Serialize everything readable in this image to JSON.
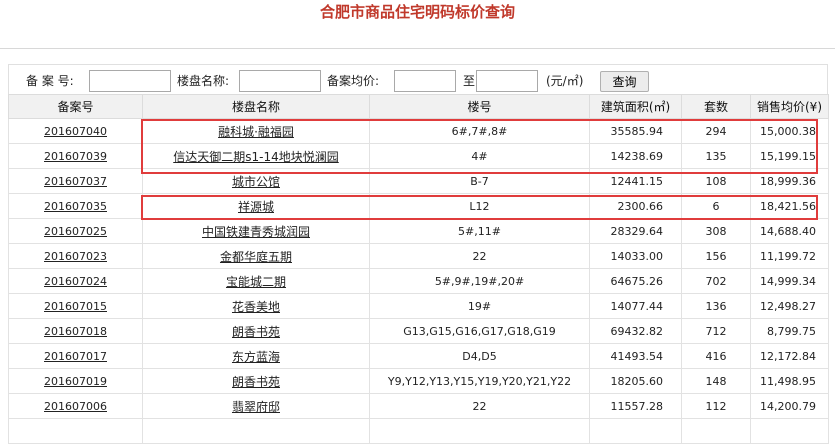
{
  "title": "合肥市商品住宅明码标价查询",
  "search": {
    "record_label": "备 案 号:",
    "name_label": "楼盘名称:",
    "price_label": "备案均价:",
    "to_label": "至",
    "unit_label": "(元/㎡)",
    "record_value": "",
    "name_value": "",
    "price_min": "",
    "price_max": "",
    "query_button": "查询"
  },
  "table": {
    "headers": [
      "备案号",
      "楼盘名称",
      "楼号",
      "建筑面积(㎡)",
      "套数",
      "销售均价(¥)"
    ],
    "rows": [
      {
        "id": "201607040",
        "name": "融科城·融福园",
        "buildings": "6#,7#,8#",
        "area": "35585.94",
        "units": "294",
        "price": "15,000.38"
      },
      {
        "id": "201607039",
        "name": "信达天御二期s1-14地块悦澜园",
        "buildings": "4#",
        "area": "14238.69",
        "units": "135",
        "price": "15,199.15"
      },
      {
        "id": "201607037",
        "name": "城市公馆",
        "buildings": "B-7",
        "area": "12441.15",
        "units": "108",
        "price": "18,999.36"
      },
      {
        "id": "201607035",
        "name": "祥源城",
        "buildings": "L12",
        "area": "2300.66",
        "units": "6",
        "price": "18,421.56"
      },
      {
        "id": "201607025",
        "name": "中国铁建青秀城润园",
        "buildings": "5#,11#",
        "area": "28329.64",
        "units": "308",
        "price": "14,688.40"
      },
      {
        "id": "201607023",
        "name": "金都华庭五期",
        "buildings": "22",
        "area": "14033.00",
        "units": "156",
        "price": "11,199.72"
      },
      {
        "id": "201607024",
        "name": "宝能城二期",
        "buildings": "5#,9#,19#,20#",
        "area": "64675.26",
        "units": "702",
        "price": "14,999.34"
      },
      {
        "id": "201607015",
        "name": "花香美地",
        "buildings": "19#",
        "area": "14077.44",
        "units": "136",
        "price": "12,498.27"
      },
      {
        "id": "201607018",
        "name": "朗香书苑",
        "buildings": "G13,G15,G16,G17,G18,G19",
        "area": "69432.82",
        "units": "712",
        "price": "8,799.75"
      },
      {
        "id": "201607017",
        "name": "东方蓝海",
        "buildings": "D4,D5",
        "area": "41493.54",
        "units": "416",
        "price": "12,172.84"
      },
      {
        "id": "201607019",
        "name": "朗香书苑",
        "buildings": "Y9,Y12,Y13,Y15,Y19,Y20,Y21,Y22",
        "area": "18205.60",
        "units": "148",
        "price": "11,498.95"
      },
      {
        "id": "201607006",
        "name": "翡翠府邸",
        "buildings": "22",
        "area": "11557.28",
        "units": "112",
        "price": "14,200.79"
      },
      {
        "id": "",
        "name": "",
        "buildings": "",
        "area": "",
        "units": "",
        "price": ""
      }
    ]
  },
  "colors": {
    "title": "#c0392b",
    "highlight": "#e03c3c",
    "header_bg": "#f1f1f1"
  }
}
